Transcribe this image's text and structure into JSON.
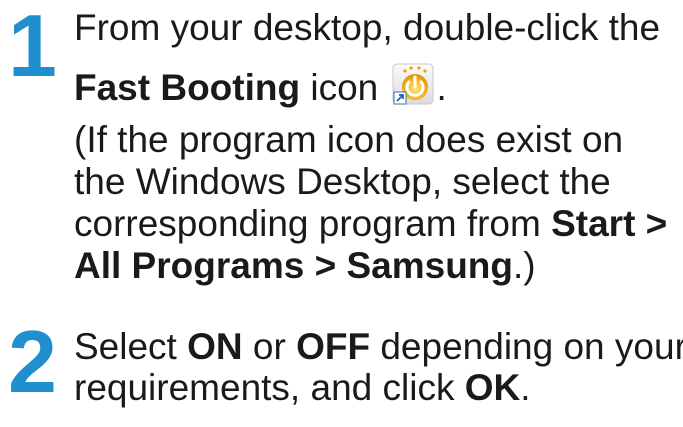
{
  "step1": {
    "number": "1",
    "line1": "From your desktop, double-click the",
    "icon_name_bold": "Fast Booting",
    "icon_word": " icon ",
    "icon": "fast-booting-icon",
    "after_icon": ".",
    "line3": "(If the program icon does exist on",
    "line4": "the Windows Desktop, select the",
    "line5_pre": "corresponding program from ",
    "line5_bold": "Start >",
    "line6_bold": "All Programs > Samsung",
    "line6_post": ".)"
  },
  "step2": {
    "number": "2",
    "pre": "Select ",
    "on": "ON",
    "or": " or ",
    "off": "OFF",
    "mid": " depending on your",
    "line2_pre": "requirements, and click ",
    "ok": "OK",
    "line2_post": "."
  },
  "colors": {
    "step_number": "#1f8fce",
    "text": "#1a1a1a"
  }
}
